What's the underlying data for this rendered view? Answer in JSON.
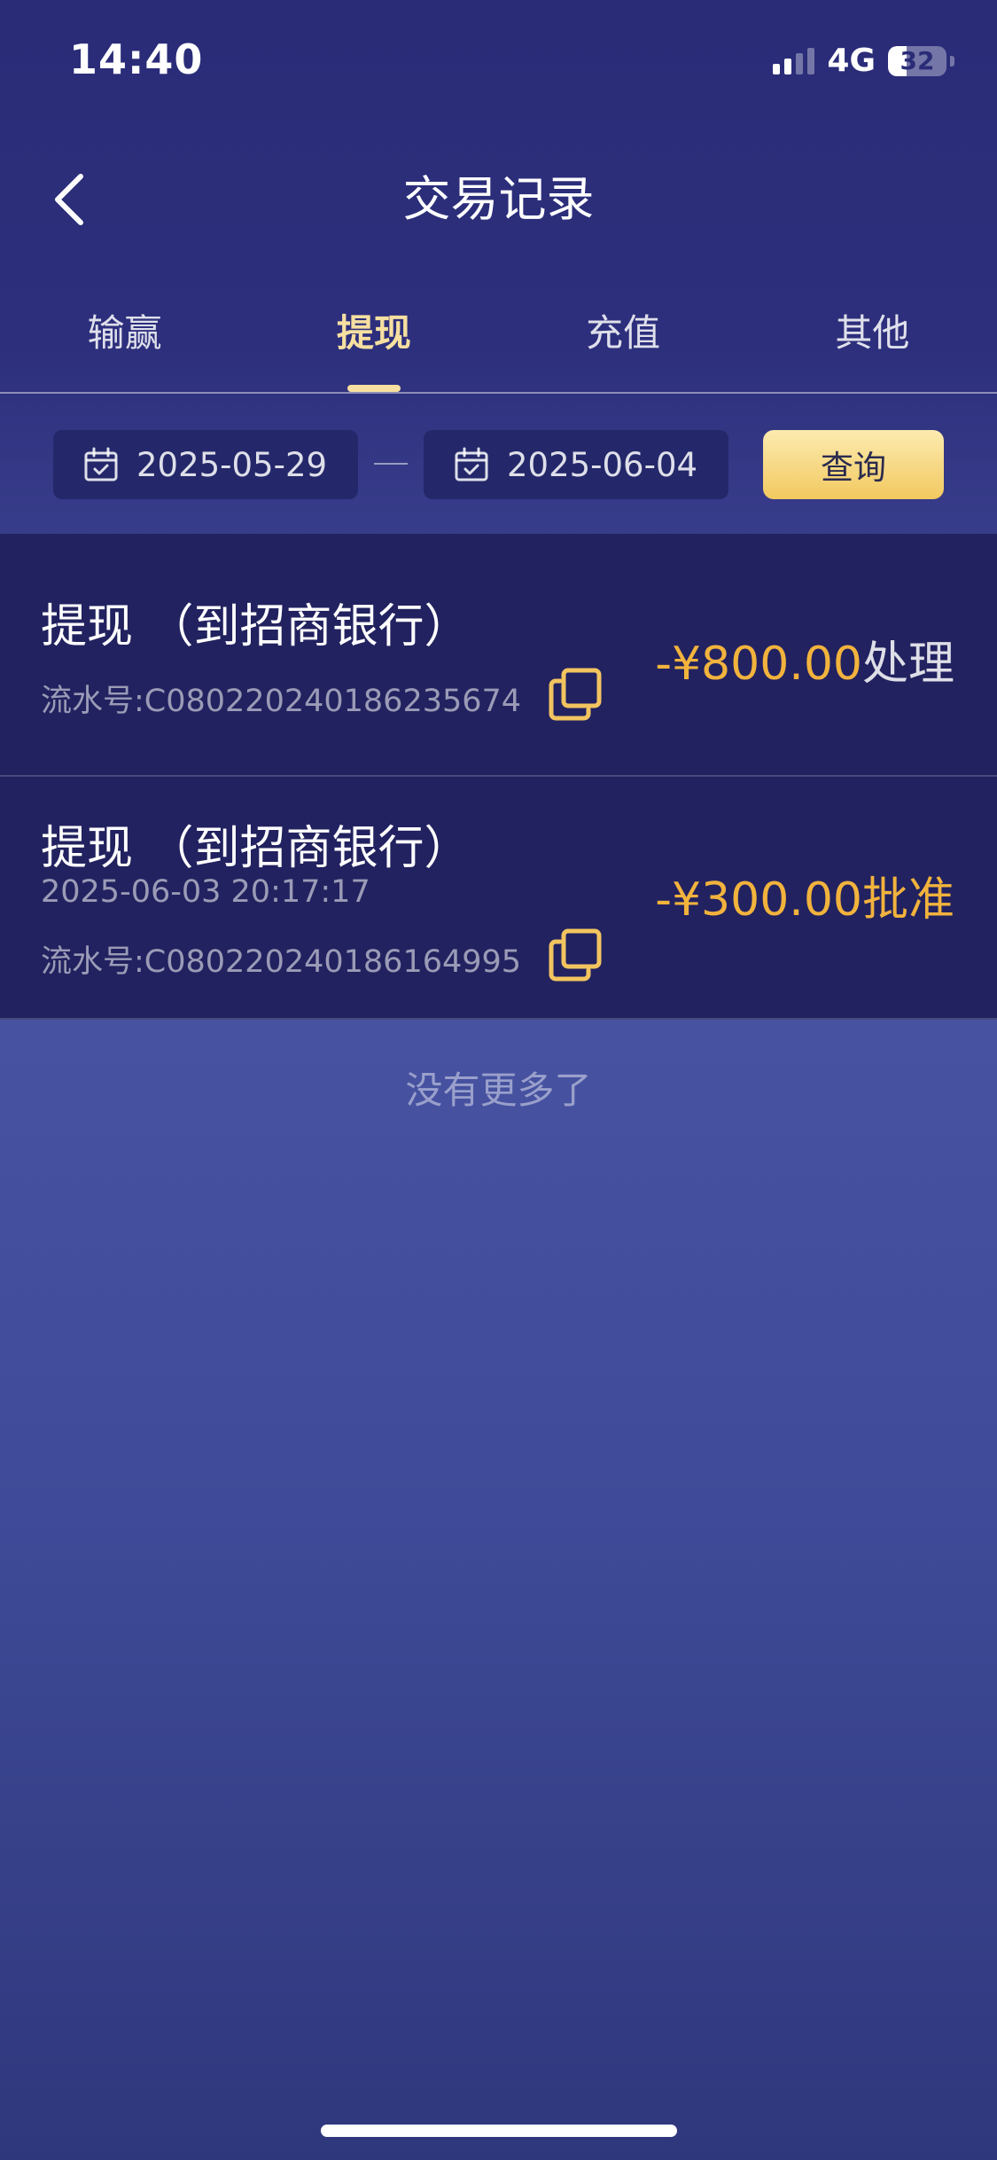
{
  "status_bar": {
    "time": "14:40",
    "network": "4G",
    "battery": "32",
    "battery_fraction": 0.32
  },
  "nav": {
    "title": "交易记录",
    "back_icon": "chevron-left-icon"
  },
  "tabs": [
    {
      "label": "输赢",
      "active": false
    },
    {
      "label": "提现",
      "active": true
    },
    {
      "label": "充值",
      "active": false
    },
    {
      "label": "其他",
      "active": false
    }
  ],
  "filter": {
    "start_date": "2025-05-29",
    "end_date": "2025-06-04",
    "query_label": "查询",
    "date_icon": "calendar-check-icon"
  },
  "records": [
    {
      "title": "提现 （到招商银行）",
      "time": "",
      "serial": "流水号:C080220240186235674",
      "amount": "-¥800.00",
      "status": "处理"
    },
    {
      "title": "提现 （到招商银行）",
      "time": "2025-06-03 20:17:17",
      "serial": "流水号:C080220240186164995",
      "amount": "-¥300.00",
      "status": "批准"
    }
  ],
  "list_end_text": "没有更多了",
  "colors": {
    "accent_gold": "#f2b33d",
    "tab_active": "#f6dfa0",
    "record_bg": "#222260"
  }
}
